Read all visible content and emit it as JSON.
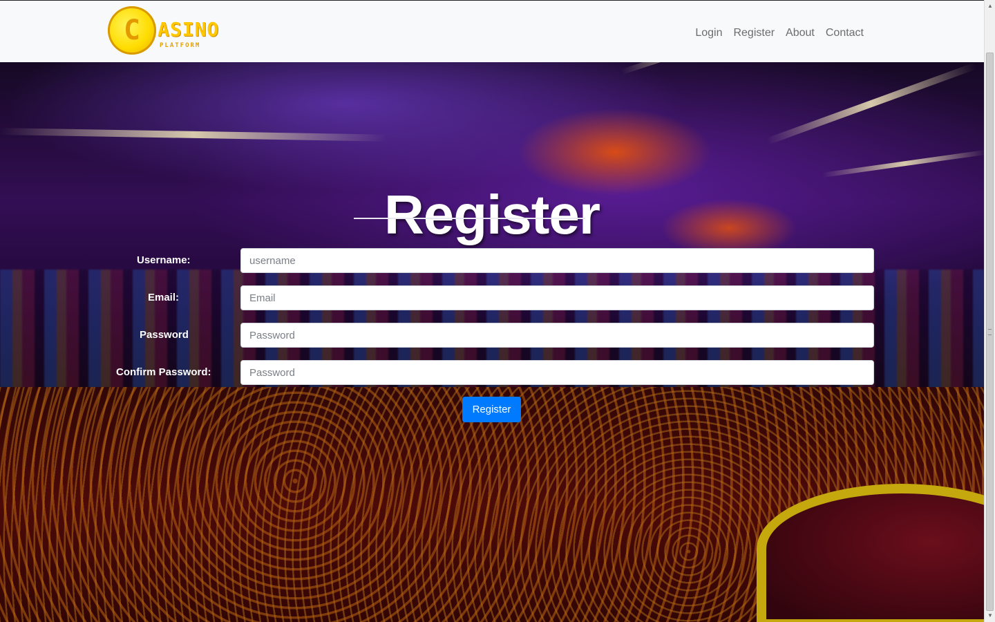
{
  "nav": {
    "brand_word": "ASINO",
    "brand_glyph": "C",
    "brand_sub": "PLATFORM",
    "links": [
      {
        "label": "Login"
      },
      {
        "label": "Register"
      },
      {
        "label": "About"
      },
      {
        "label": "Contact"
      }
    ]
  },
  "form": {
    "title": "Register",
    "fields": [
      {
        "label": "Username:",
        "placeholder": "username",
        "value": ""
      },
      {
        "label": "Email:",
        "placeholder": "Email",
        "value": ""
      },
      {
        "label": "Password",
        "placeholder": "Password",
        "value": ""
      },
      {
        "label": "Confirm Password:",
        "placeholder": "Password",
        "value": ""
      }
    ],
    "submit_label": "Register"
  },
  "colors": {
    "navbar_bg": "#f8f9fa",
    "nav_link": "#6c6c6c",
    "primary_button": "#007bff",
    "brand_gold": "#ffc800"
  },
  "icons": {
    "logo": "casino-coin-logo",
    "scroll_up": "scroll-up-arrow-icon",
    "scroll_down": "scroll-down-arrow-icon"
  }
}
